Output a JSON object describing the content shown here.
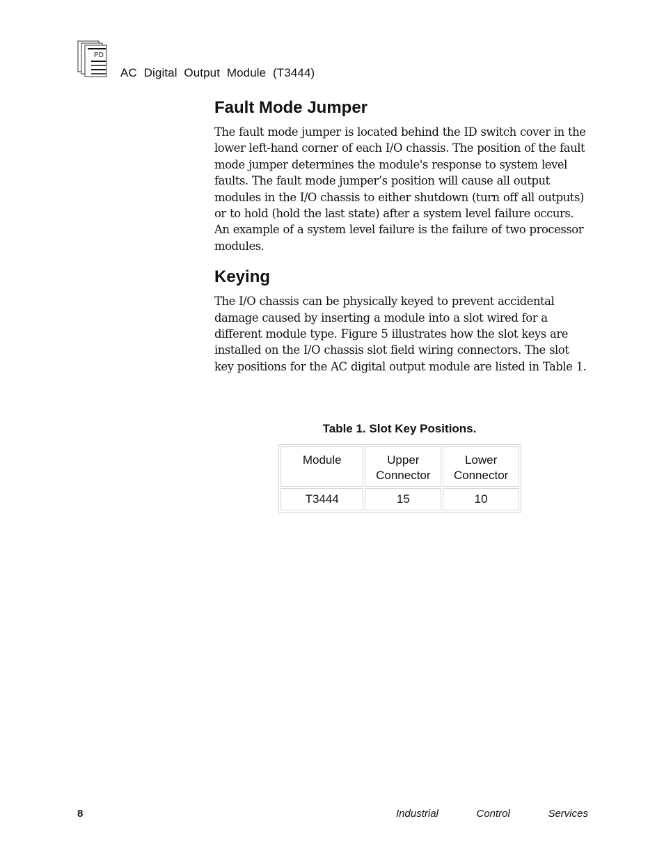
{
  "header": {
    "logo_icon": "pd-document-stack-icon",
    "logo_text": "PD",
    "title": "AC Digital Output Module (T3444)"
  },
  "sections": [
    {
      "heading": "Fault Mode Jumper",
      "body": "The fault mode jumper is located behind the ID switch cover in the lower left-hand corner of each I/O chassis.  The position of the fault mode jumper determines the module's response to system level faults.  The fault mode jumper’s position will cause all output modules in the I/O chassis to either shutdown (turn off all outputs) or to hold (hold the last state) after a system level failure occurs.  An example of a system level failure is the failure of two processor modules."
    },
    {
      "heading": "Keying",
      "body": "The I/O chassis can be physically keyed to prevent accidental damage caused by inserting a module into a slot wired for a different module type.  Figure 5 illustrates how the slot keys are installed on the I/O chassis slot field wiring connectors.  The slot key positions for the AC digital output module are listed in Table 1."
    }
  ],
  "table": {
    "caption": "Table 1.  Slot Key Positions.",
    "columns": [
      "Module",
      "Upper Connector",
      "Lower Connector"
    ],
    "columns_lines": [
      [
        "Module"
      ],
      [
        "Upper",
        "Connector"
      ],
      [
        "Lower",
        "Connector"
      ]
    ],
    "rows": [
      [
        "T3444",
        "15",
        "10"
      ]
    ]
  },
  "footer": {
    "page_number": "8",
    "company_words": [
      "Industrial",
      "Control",
      "Services"
    ]
  }
}
